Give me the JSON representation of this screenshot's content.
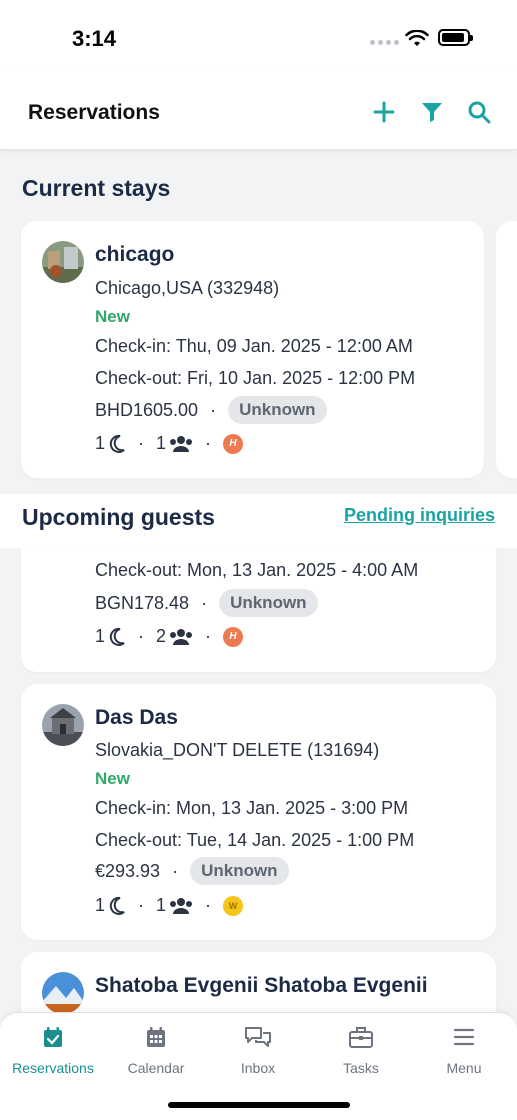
{
  "status_bar": {
    "time": "3:14"
  },
  "header": {
    "title": "Reservations"
  },
  "current_stays": {
    "title": "Current stays",
    "cards": [
      {
        "name": "chicago",
        "property": "Chicago,USA (332948)",
        "status": "New",
        "checkin": "Check-in: Thu, 09 Jan. 2025 - 12:00 AM",
        "checkout": "Check-out: Fri, 10 Jan. 2025 - 12:00 PM",
        "price": "BHD1605.00",
        "badge": "Unknown",
        "nights": "1",
        "guests": "1",
        "source_icon": "H"
      }
    ]
  },
  "upcoming": {
    "title": "Upcoming guests",
    "pending_link": "Pending inquiries",
    "cards": [
      {
        "checkout": "Check-out: Mon, 13 Jan. 2025 - 4:00 AM",
        "price": "BGN178.48",
        "badge": "Unknown",
        "nights": "1",
        "guests": "2",
        "source_icon": "H"
      },
      {
        "name": "Das Das",
        "property": "Slovakia_DON'T DELETE (131694)",
        "status": "New",
        "checkin": "Check-in: Mon, 13 Jan. 2025 - 3:00 PM",
        "checkout": "Check-out: Tue, 14 Jan. 2025 - 1:00 PM",
        "price": "€293.93",
        "badge": "Unknown",
        "nights": "1",
        "guests": "1",
        "source_icon": "W"
      },
      {
        "name": "Shatoba Evgenii Shatoba Evgenii"
      }
    ]
  },
  "tabbar": {
    "tabs": [
      {
        "label": "Reservations",
        "icon": "calendar-check-icon",
        "active": true
      },
      {
        "label": "Calendar",
        "icon": "calendar-grid-icon",
        "active": false
      },
      {
        "label": "Inbox",
        "icon": "chat-bubbles-icon",
        "active": false
      },
      {
        "label": "Tasks",
        "icon": "briefcase-icon",
        "active": false
      },
      {
        "label": "Menu",
        "icon": "hamburger-icon",
        "active": false
      }
    ]
  },
  "colors": {
    "accent": "#1aa3a3",
    "new_status": "#2fa86a",
    "badge_bg": "#e4e6ea",
    "source_h": "#ee7a52",
    "source_w": "#f5c518"
  }
}
